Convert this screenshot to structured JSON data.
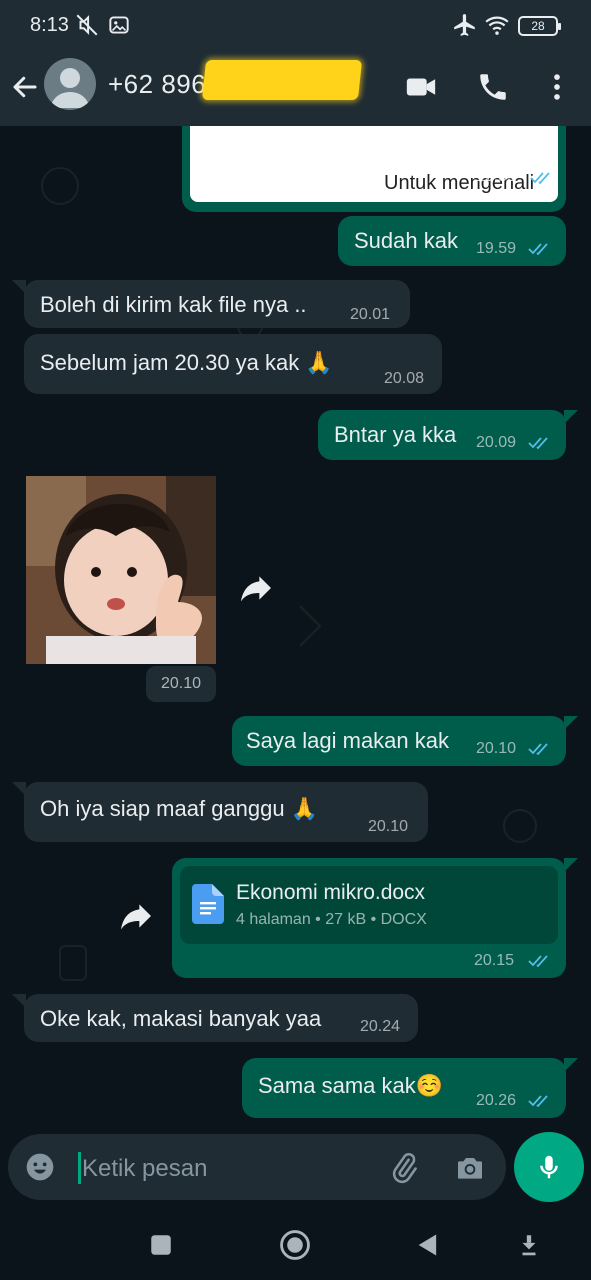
{
  "status_bar": {
    "time": "8:13",
    "battery": "28",
    "icons": [
      "mute-icon",
      "gallery-notification-icon",
      "airplane-icon",
      "wifi-icon",
      "battery-icon"
    ]
  },
  "header": {
    "contact_name": "+62 896",
    "icons": [
      "back-arrow-icon",
      "avatar-icon",
      "video-call-icon",
      "voice-call-icon",
      "more-vertical-icon"
    ]
  },
  "messages": [
    {
      "direction": "out",
      "type": "image-preview",
      "caption": "Untuk mengenali",
      "time": "19.59",
      "ticks": "read"
    },
    {
      "direction": "out",
      "type": "text",
      "text": "Sudah kak",
      "time": "19.59",
      "ticks": "read"
    },
    {
      "direction": "in",
      "type": "text",
      "text": "Boleh di kirim kak file nya ..",
      "time": "20.01"
    },
    {
      "direction": "in",
      "type": "text",
      "text": "Sebelum jam 20.30 ya kak 🙏",
      "time": "20.08"
    },
    {
      "direction": "out",
      "type": "text",
      "text": "Bntar ya kka",
      "time": "20.09",
      "ticks": "read"
    },
    {
      "direction": "in",
      "type": "sticker",
      "time": "20.10"
    },
    {
      "direction": "out",
      "type": "text",
      "text": "Saya lagi makan kak",
      "time": "20.10",
      "ticks": "read"
    },
    {
      "direction": "in",
      "type": "text",
      "text": "Oh iya siap maaf ganggu 🙏",
      "time": "20.10"
    },
    {
      "direction": "out",
      "type": "document",
      "file_name": "Ekonomi mikro.docx",
      "file_meta": "4 halaman • 27 kB • DOCX",
      "time": "20.15",
      "ticks": "read"
    },
    {
      "direction": "in",
      "type": "text",
      "text": "Oke kak, makasi banyak yaa",
      "time": "20.24"
    },
    {
      "direction": "out",
      "type": "text",
      "text": "Sama sama kak☺️",
      "time": "20.26",
      "ticks": "read"
    }
  ],
  "input": {
    "placeholder": "Ketik pesan",
    "icons": [
      "emoji-icon",
      "attach-icon",
      "camera-icon",
      "mic-icon"
    ]
  },
  "nav_bar": {
    "icons": [
      "recents-square-icon",
      "home-circle-icon",
      "back-triangle-icon",
      "nav-menu-icon"
    ]
  },
  "colors": {
    "outgoing_bubble": "#005c4b",
    "incoming_bubble": "#1f2c34",
    "background": "#0b141a",
    "accent": "#00a884",
    "read_ticks": "#53bdeb"
  }
}
